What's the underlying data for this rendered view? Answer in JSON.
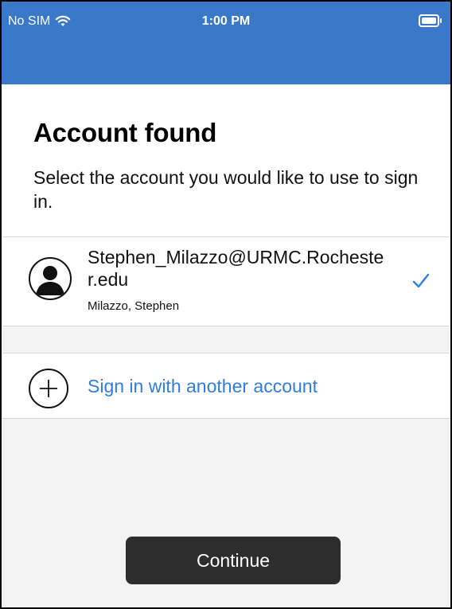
{
  "status_bar": {
    "carrier": "No SIM",
    "time": "1:00 PM"
  },
  "page": {
    "title": "Account found",
    "subtitle": "Select the account you would like to use to sign in."
  },
  "account": {
    "email": "Stephen_Milazzo@URMC.Rochester.edu",
    "name": "Milazzo, Stephen",
    "selected_icon": "checkmark-icon"
  },
  "add_account": {
    "label": "Sign in with another account",
    "icon": "plus-circle-icon"
  },
  "actions": {
    "continue_label": "Continue"
  },
  "colors": {
    "header_blue": "#3a78c9",
    "link_blue": "#2f7de1",
    "button_dark": "#2d2d2d"
  }
}
